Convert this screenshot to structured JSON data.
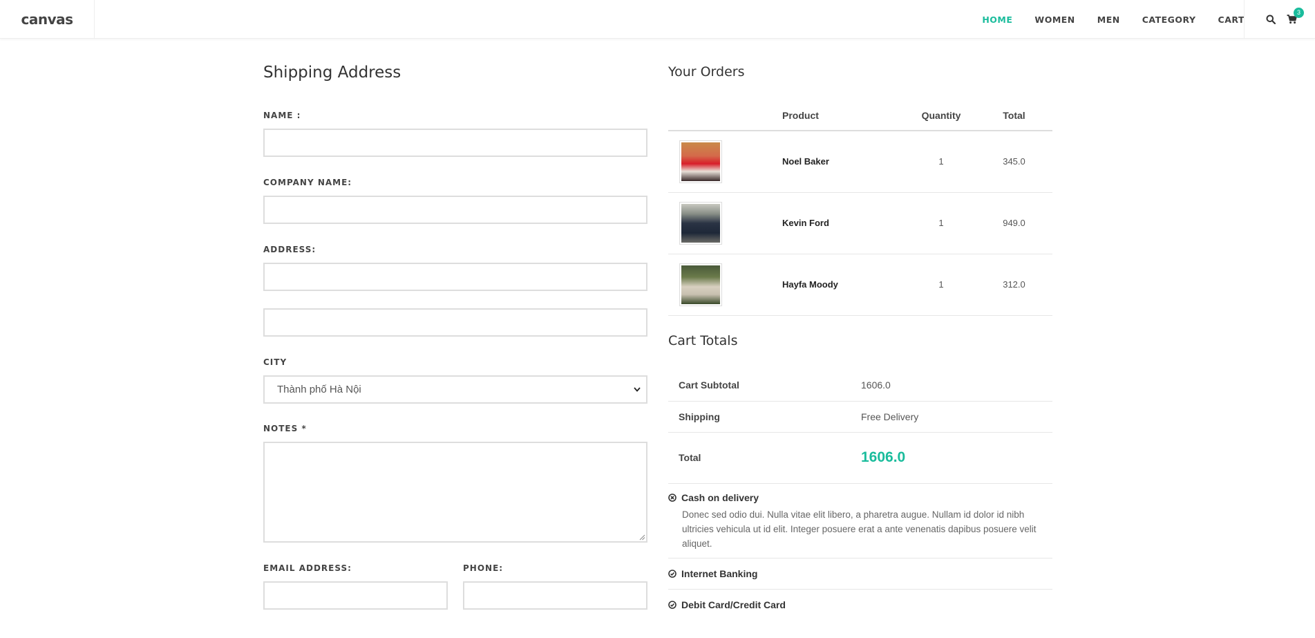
{
  "header": {
    "logo": "canvas",
    "nav": [
      "HOME",
      "WOMEN",
      "MEN",
      "CATEGORY",
      "CART"
    ],
    "cart_count": "3",
    "colors": {
      "accent": "#1abc9c"
    }
  },
  "shipping": {
    "title": "Shipping Address",
    "name_label": "NAME :",
    "company_label": "COMPANY NAME:",
    "address_label": "ADDRESS:",
    "city_label": "CITY",
    "city_value": "Thành phố Hà Nội",
    "notes_label": "NOTES *",
    "email_label": "EMAIL ADDRESS:",
    "phone_label": "PHONE:"
  },
  "orders": {
    "title": "Your Orders",
    "headers": [
      "",
      "Product",
      "Quantity",
      "Total"
    ],
    "rows": [
      {
        "name": "Noel Baker",
        "qty": "1",
        "total": "345.0"
      },
      {
        "name": "Kevin Ford",
        "qty": "1",
        "total": "949.0"
      },
      {
        "name": "Hayfa Moody",
        "qty": "1",
        "total": "312.0"
      }
    ]
  },
  "totals": {
    "title": "Cart Totals",
    "subtotal_label": "Cart Subtotal",
    "subtotal_value": "1606.0",
    "shipping_label": "Shipping",
    "shipping_value": "Free Delivery",
    "total_label": "Total",
    "total_value": "1606.0"
  },
  "payment": {
    "methods": [
      {
        "label": "Cash on delivery",
        "desc": "Donec sed odio dui. Nulla vitae elit libero, a pharetra augue. Nullam id dolor id nibh ultricies vehicula ut id elit. Integer posuere erat a ante venenatis dapibus posuere velit aliquet."
      },
      {
        "label": "Internet Banking"
      },
      {
        "label": "Debit Card/Credit Card"
      }
    ]
  }
}
